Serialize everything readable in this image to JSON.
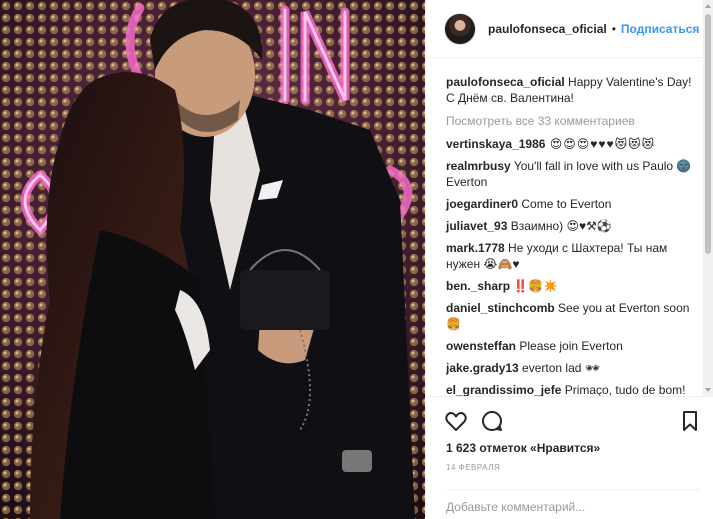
{
  "header": {
    "username": "paulofonseca_oficial",
    "separator": "•",
    "follow_label": "Подписаться"
  },
  "caption": {
    "username": "paulofonseca_oficial",
    "text": " Happy Valentine's Day! С Днём св. Валентина!"
  },
  "view_all_comments": "Посмотреть все 33 комментариев",
  "comments": [
    {
      "username": "vertinskaya_1986",
      "text": " 😍😍😍♥♥♥😻😻😻"
    },
    {
      "username": "realmrbusy",
      "text": " You'll fall in love with us Paulo 🌚 Everton"
    },
    {
      "username": "joegardiner0",
      "text": " Come to Everton"
    },
    {
      "username": "juliavet_93",
      "text": " Взаимно) 😍♥⚒⚽"
    },
    {
      "username": "mark.1778",
      "text": " Не уходи с Шахтера! Ты нам нужен 😭🙈♥"
    },
    {
      "username": "ben._sharp",
      "text": " ‼️🍔✴️"
    },
    {
      "username": "daniel_stinchcomb",
      "text": " See you at Everton soon 🍔"
    },
    {
      "username": "owensteffan",
      "text": " Please join Everton"
    },
    {
      "username": "jake.grady13",
      "text": " everton lad 🕶"
    },
    {
      "username": "el_grandissimo_jefe",
      "text": " Primaço, tudo de bom!"
    }
  ],
  "likes": "1 623 отметок «Нравится»",
  "date": "14 ФЕВРАЛЯ",
  "add_comment_placeholder": "Добавьте комментарий..."
}
